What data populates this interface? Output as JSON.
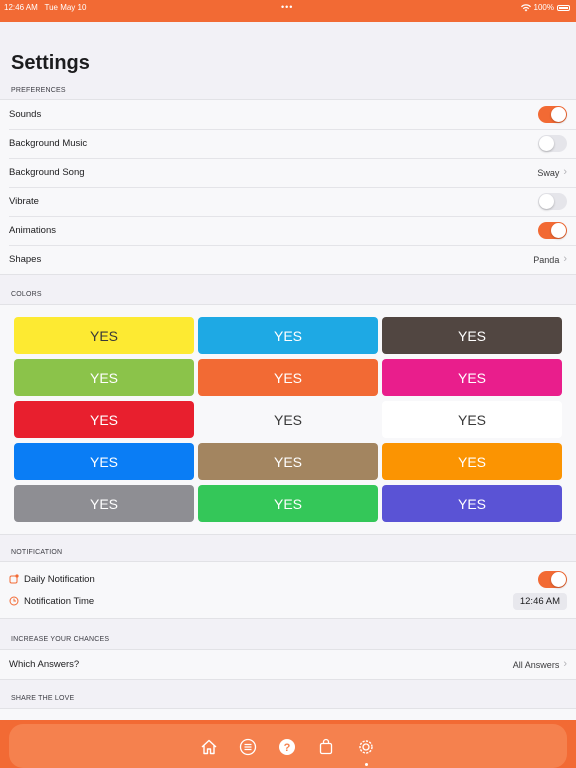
{
  "status": {
    "time": "12:46 AM",
    "date": "Tue May 10",
    "dots": "•••",
    "battery": "100%"
  },
  "page": {
    "title": "Settings"
  },
  "preferences": {
    "header": "PREFERENCES",
    "sounds": {
      "label": "Sounds",
      "on": true
    },
    "background_music": {
      "label": "Background Music",
      "on": false
    },
    "background_song": {
      "label": "Background Song",
      "value": "Sway"
    },
    "vibrate": {
      "label": "Vibrate",
      "on": false
    },
    "animations": {
      "label": "Animations",
      "on": true
    },
    "shapes": {
      "label": "Shapes",
      "value": "Panda"
    }
  },
  "colors": {
    "header": "COLORS",
    "swatches": [
      {
        "label": "YES",
        "bg": "#fdea32",
        "fg": "#3a3a3a"
      },
      {
        "label": "YES",
        "bg": "#1ea9e4",
        "fg": "#ffffff"
      },
      {
        "label": "YES",
        "bg": "#514641",
        "fg": "#ffffff"
      },
      {
        "label": "YES",
        "bg": "#8bc34a",
        "fg": "#ffffff"
      },
      {
        "label": "YES",
        "bg": "#f26a34",
        "fg": "#ffffff"
      },
      {
        "label": "YES",
        "bg": "#e91e8c",
        "fg": "#ffffff"
      },
      {
        "label": "YES",
        "bg": "#e81f2e",
        "fg": "#ffffff"
      },
      {
        "label": "YES",
        "bg": "#f8f8fa",
        "fg": "#3a3a3a"
      },
      {
        "label": "YES",
        "bg": "#ffffff",
        "fg": "#3a3a3a"
      },
      {
        "label": "YES",
        "bg": "#0a7df5",
        "fg": "#ffffff"
      },
      {
        "label": "YES",
        "bg": "#a38560",
        "fg": "#ffffff"
      },
      {
        "label": "YES",
        "bg": "#fb9402",
        "fg": "#ffffff"
      },
      {
        "label": "YES",
        "bg": "#8e8e93",
        "fg": "#ffffff"
      },
      {
        "label": "YES",
        "bg": "#34c759",
        "fg": "#ffffff"
      },
      {
        "label": "YES",
        "bg": "#5a53d5",
        "fg": "#ffffff"
      }
    ]
  },
  "notification": {
    "header": "NOTIFICATION",
    "daily": {
      "label": "Daily Notification",
      "on": true
    },
    "time": {
      "label": "Notification Time",
      "value": "12:46 AM"
    }
  },
  "chances": {
    "header": "INCREASE YOUR CHANCES",
    "which": {
      "label": "Which Answers?",
      "value": "All Answers"
    }
  },
  "share": {
    "header": "SHARE THE LOVE"
  },
  "tabbar": {
    "items": [
      "home-icon",
      "list-icon",
      "help-icon",
      "bag-icon",
      "settings-icon"
    ],
    "selected": "settings-icon"
  },
  "accent": "#f26a34"
}
